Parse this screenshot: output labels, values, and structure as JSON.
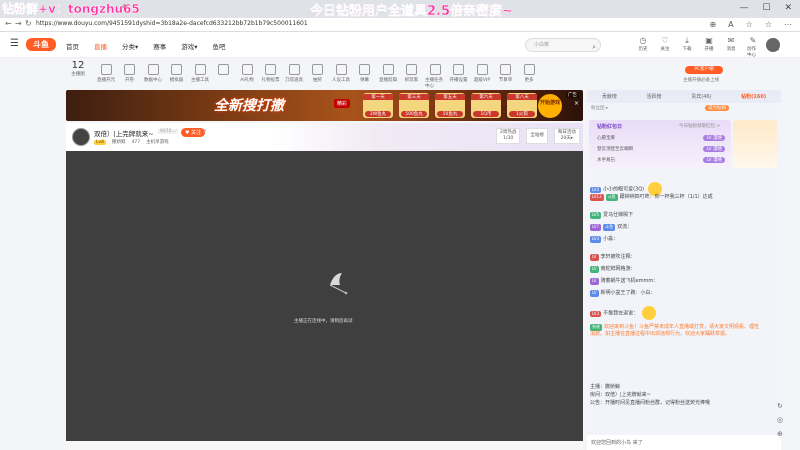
{
  "overlay": {
    "left_text": "钻粉群+v：tongzhu65",
    "center_text": "今日钻粉用户全道具2.5倍亲密度~"
  },
  "browser": {
    "new_tab": "+",
    "window_controls": [
      "—",
      "☐",
      "✕"
    ],
    "nav": [
      "←",
      "→",
      "↻"
    ],
    "url": "https://www.douyu.com/9451591dyshid=3b18a2e-dacefcd633212bb72b1b79c500011601",
    "addr_icons": [
      "⊕",
      "A",
      "☆",
      "☆",
      "⋯"
    ]
  },
  "header": {
    "logo": "斗鱼",
    "nav": [
      {
        "label": "首页",
        "active": false
      },
      {
        "label": "直播",
        "active": true
      },
      {
        "label": "分类▾",
        "active": false
      },
      {
        "label": "赛事",
        "active": false
      },
      {
        "label": "游戏▾",
        "active": false
      },
      {
        "label": "鱼吧",
        "active": false
      }
    ],
    "search_placeholder": "小白菜",
    "icons": [
      {
        "label": "历史",
        "glyph": "◷"
      },
      {
        "label": "关注",
        "glyph": "♡"
      },
      {
        "label": "下载",
        "glyph": "⤓"
      },
      {
        "label": "开播",
        "glyph": "▣"
      },
      {
        "label": "消息",
        "glyph": "✉"
      },
      {
        "label": "创作中心",
        "glyph": "✎"
      },
      {
        "label": "钻粉",
        "glyph": "◆"
      }
    ]
  },
  "categories": {
    "first": {
      "count": "12",
      "label": "主播图"
    },
    "items": [
      "直播开元",
      "开卷",
      "数据中心",
      "模拟器",
      "主播工具",
      "",
      "AI礼物",
      "礼物投票",
      "刀塔道具",
      "抽奖",
      "人设工具",
      "弹幕",
      "直播剪辑",
      "抓玩家",
      "主播任务中心",
      "开播设置",
      "超级VIP",
      "节目单",
      "更多"
    ],
    "pc_button": "PC客户端",
    "pc_sub": "主播开播必备上线"
  },
  "banner": {
    "title": "全新搜打撤",
    "tag": "精彩",
    "boxes": [
      {
        "day": "第一天",
        "reward": "2W鱼丸"
      },
      {
        "day": "第三天",
        "reward": "500鱼丸"
      },
      {
        "day": "第五天",
        "reward": "50鱼丸"
      },
      {
        "day": "第六天",
        "reward": "1Q币"
      },
      {
        "day": "第八天",
        "reward": "1火箭"
      }
    ],
    "open_button": "开始游戏",
    "ad_label": "广告",
    "close": "×"
  },
  "room": {
    "title": "双倍）|上完牌就来~",
    "room_id": "9372...",
    "follow": "♥ 关注",
    "share": "↗",
    "level": "Lv8",
    "streamer": "撒娇鲸",
    "fans": "477",
    "category": "主机单游戏",
    "right_boxes": [
      "2周热战\n1/30",
      "全站榜",
      "每日活动\n20天▸"
    ]
  },
  "video": {
    "loading_text": "主播正在连线中，请稍后再试"
  },
  "right_panel": {
    "tabs": [
      {
        "label": "贡献榜",
        "selected": false
      },
      {
        "label": "活跃榜",
        "selected": false
      },
      {
        "label": "贵宾(46)",
        "selected": false
      },
      {
        "label": "钻粉(160)",
        "selected": true
      }
    ],
    "sub_left": "粉丝团 ▸",
    "sub_right": "成为钻粉",
    "rank_title": "钻粉红包日",
    "rank_right": "今日钻粉领取红包 >",
    "rank_rows": [
      {
        "name": "心愿宝库",
        "badge": "LV 漫嘻"
      },
      {
        "name": "登云顶登至云端瞬",
        "badge": "LV 漫嘻"
      },
      {
        "name": "水手易石",
        "badge": "LV 漫嘻"
      }
    ],
    "messages": [
      {
        "tags": [
          "LV4"
        ],
        "user": "",
        "text": "小小的眼可爱(3Q)"
      },
      {
        "tags": [
          "LV13",
          "斗鱼"
        ],
        "user": "",
        "text": "跟钟钟四叮咚：你一杯我三杯（1/1）达成"
      },
      {
        "tags": [
          "LV5"
        ],
        "user": "",
        "text": "爱马仕嫁殿下"
      },
      {
        "tags": [
          "LV7",
          "斗鱼"
        ],
        "user": "",
        "text": "双流："
      },
      {
        "tags": [
          "LV3"
        ],
        "user": "",
        "text": "小淼："
      },
      {
        "tags": [
          "LV"
        ],
        "user": "",
        "text": "李轩被吹注释："
      },
      {
        "tags": [
          "LV"
        ],
        "user": "",
        "text": "南蛇鲜网格游："
      },
      {
        "tags": [
          "LV"
        ],
        "user": "",
        "text": "骑着蜗牛送飞机emmm："
      },
      {
        "tags": [
          "LV"
        ],
        "user": "",
        "text": "新明小盆王了跑：小白："
      },
      {
        "tags": [
          "LV3"
        ],
        "user": "",
        "text": "不像我在逗说："
      },
      {
        "tags": [
          "系统"
        ],
        "user": "",
        "text": "欢迎来到斗鱼！斗鱼严禁未成年人直播或打赏，请大家文明观看、理性消费。如主播在直播过程中出现违规行为，欢迎大家踊跃举报。"
      },
      {
        "tags": [],
        "user": "",
        "text": "主播：撒娇鲸"
      },
      {
        "tags": [],
        "user": "",
        "text": "房间：双倍）|上完牌就来~"
      },
      {
        "tags": [],
        "user": "",
        "text": "公告：开播时间见直播间粉丝群，记得粉丝送荧光棒哦"
      }
    ],
    "welcome": "欢迎您回到的小鸟 来了"
  },
  "side_tools": [
    "↻",
    "◎",
    "⊕"
  ]
}
